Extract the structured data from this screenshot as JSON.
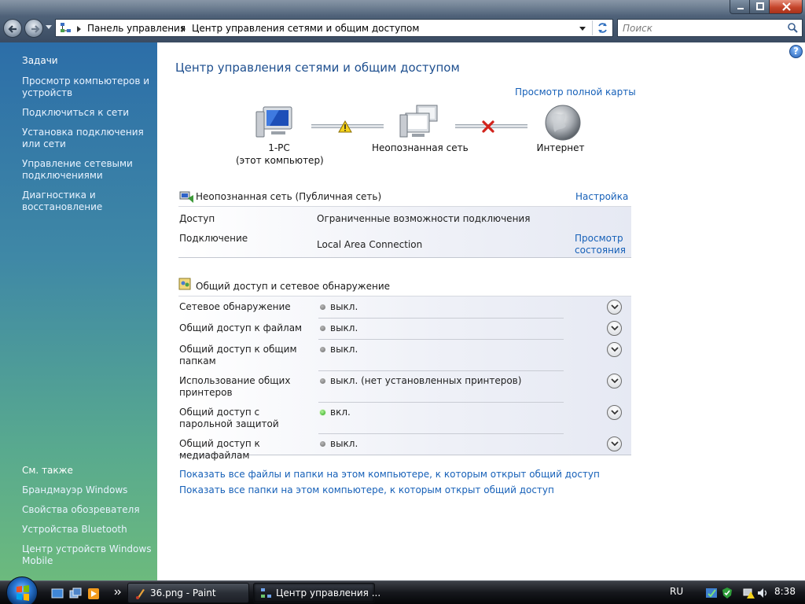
{
  "address": {
    "crumbs": [
      "Панель управления",
      "Центр управления сетями и общим доступом"
    ],
    "search_placeholder": "Поиск"
  },
  "left_pane": {
    "tasks_heading": "Задачи",
    "tasks": [
      "Просмотр компьютеров и устройств",
      "Подключиться к сети",
      "Установка подключения или сети",
      "Управление сетевыми подключениями",
      "Диагностика и восстановление"
    ],
    "see_also_heading": "См. также",
    "see_also": [
      "Брандмауэр Windows",
      "Свойства обозревателя",
      "Устройства Bluetooth",
      "Центр устройств Windows Mobile"
    ]
  },
  "main": {
    "title": "Центр управления сетями и общим доступом",
    "full_map_link": "Просмотр полной карты",
    "map": {
      "computer_name": "1-PC",
      "computer_sub": "(этот компьютер)",
      "network_name": "Неопознанная сеть",
      "internet_name": "Интернет"
    },
    "network": {
      "heading": "Неопознанная сеть (Публичная сеть)",
      "customize_link": "Настройка",
      "rows": [
        {
          "label": "Доступ",
          "value": "Ограниченные возможности подключения"
        },
        {
          "label": "Подключение",
          "value": "Local Area Connection"
        }
      ],
      "view_status_link": [
        "Просмотр",
        "состояния"
      ]
    },
    "sharing": {
      "heading": "Общий доступ и сетевое обнаружение",
      "rows": [
        {
          "label": "Сетевое обнаружение",
          "value": "выкл.",
          "on": false
        },
        {
          "label": "Общий доступ к файлам",
          "value": "выкл.",
          "on": false
        },
        {
          "label": "Общий доступ к общим папкам",
          "value": "выкл.",
          "on": false
        },
        {
          "label": "Использование общих принтеров",
          "value": "выкл. (нет установленных принтеров)",
          "on": false
        },
        {
          "label": "Общий доступ с парольной защитой",
          "value": "вкл.",
          "on": true
        },
        {
          "label": "Общий доступ к медиафайлам",
          "value": "выкл.",
          "on": false
        }
      ]
    },
    "bottom_links": [
      "Показать все файлы и папки на этом компьютере, к которым открыт общий доступ",
      "Показать все папки на этом компьютере, к которым открыт общий доступ"
    ]
  },
  "taskbar": {
    "tasks": [
      "36.png - Paint",
      "Центр управления ..."
    ],
    "language": "RU",
    "clock": "8:38"
  },
  "colors": {
    "link": "#1660b8",
    "title": "#1e4f8f",
    "status_on": "#26a41b",
    "status_off": "#7a7a7a"
  }
}
